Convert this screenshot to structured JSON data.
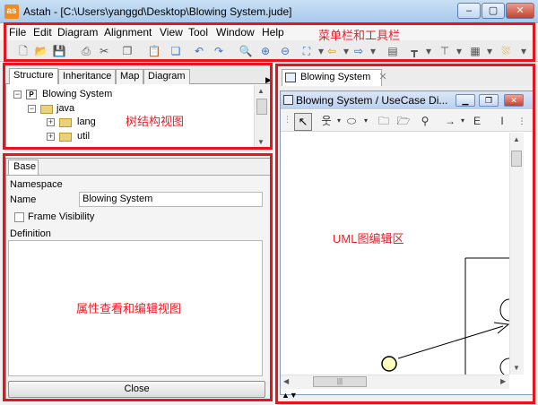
{
  "window": {
    "title": "Astah - [C:\\Users\\yanggd\\Desktop\\Blowing System.jude]",
    "app_icon_text": "as",
    "minimize_glyph": "–",
    "maximize_glyph": "▢",
    "close_glyph": "✕"
  },
  "menubar": {
    "items": [
      "File",
      "Edit",
      "Diagram",
      "Alignment",
      "View",
      "Tool",
      "Window",
      "Help"
    ]
  },
  "toolbar": {
    "icons": [
      "new-icon",
      "open-icon",
      "save-icon",
      "print-icon",
      "cut-icon",
      "copy-icon",
      "paste-icon",
      "undo-icon",
      "redo-icon",
      "zoom-icon",
      "zoom-in-icon",
      "zoom-out-icon",
      "fit-icon",
      "back-icon",
      "forward-icon",
      "align-icon",
      "align-top-icon",
      "distribute-icon",
      "layer-icon",
      "paint-icon"
    ]
  },
  "annotations": {
    "menubar_toolbar": "菜单栏和工具栏",
    "tree_view": "树结构视图",
    "properties_view": "属性查看和编辑视图",
    "uml_editor": "UML图编辑区"
  },
  "structure_panel": {
    "tabs": [
      "Structure",
      "Inheritance",
      "Map",
      "Diagram"
    ],
    "active_tab": "Structure",
    "tree": [
      {
        "label": "Blowing System",
        "icon": "project-icon",
        "expander": "−",
        "icon_text": "P"
      },
      {
        "label": "java",
        "icon": "folder-icon",
        "expander": "−"
      },
      {
        "label": "lang",
        "icon": "folder-icon",
        "expander": "+"
      },
      {
        "label": "util",
        "icon": "folder-icon",
        "expander": "+"
      }
    ]
  },
  "properties_panel": {
    "tab_label": "Base",
    "namespace_label": "Namespace",
    "name_label": "Name",
    "name_value": "Blowing System",
    "frame_visibility_label": "Frame Visibility",
    "frame_visibility_checked": false,
    "definition_label": "Definition",
    "close_label": "Close"
  },
  "editor": {
    "tab_label": "Blowing System",
    "tab_close_glyph": "✕",
    "inner_title": "Blowing System / UseCase Di...",
    "inner_min_glyph": "▁",
    "inner_restore_glyph": "❐",
    "inner_close_glyph": "✕"
  },
  "diagram_tools": {
    "select_glyph": "↖",
    "tool_icons": [
      "select-icon",
      "actor-icon",
      "usecase-icon",
      "package-icon",
      "subsystem-icon",
      "interface-icon",
      "association-icon",
      "extend-icon",
      "include-icon"
    ],
    "extend_text": "E",
    "include_text": "I"
  },
  "colors": {
    "annotation_red": "#e8141c",
    "titlebar": "#b8d3f0"
  }
}
